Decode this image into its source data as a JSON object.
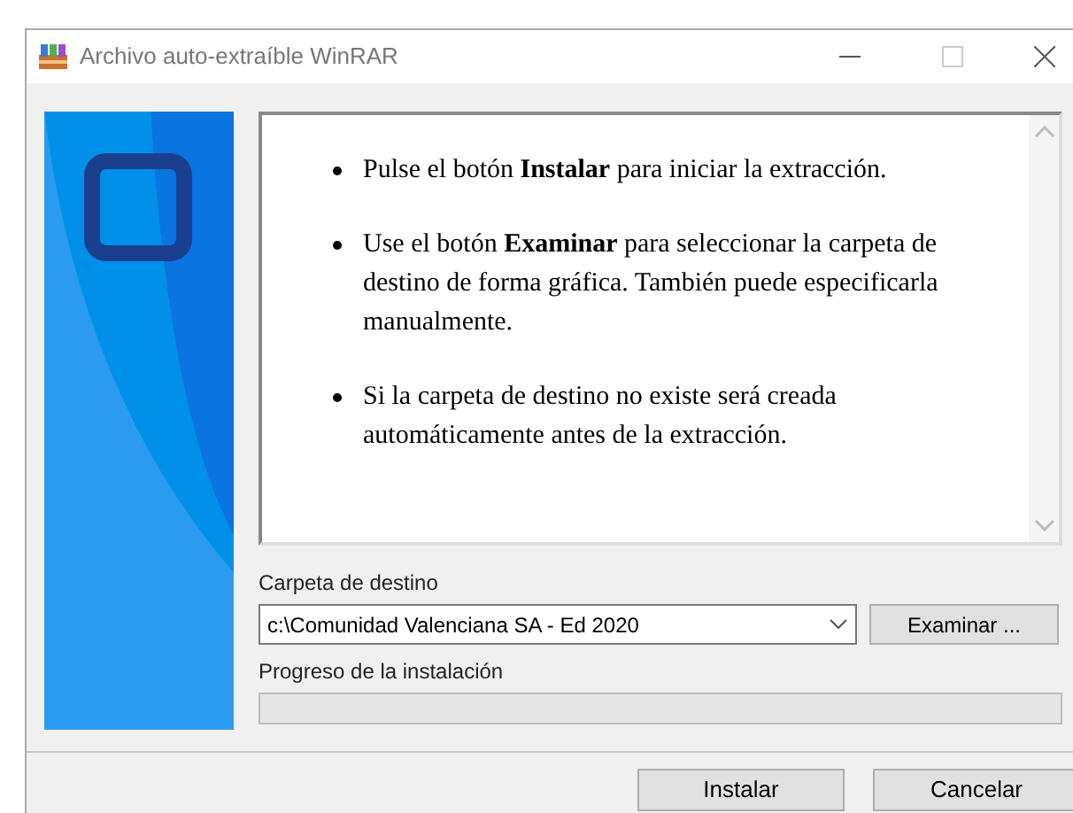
{
  "window": {
    "title": "Archivo auto-extraíble WinRAR"
  },
  "info": {
    "items": [
      "Pulse el botón **Instalar** para iniciar la extracción.",
      "Use el botón **Examinar** para seleccionar la carpeta de destino de forma gráfica. También puede especificarla manualmente.",
      "Si la carpeta de destino no existe será creada automáticamente antes de la extracción."
    ]
  },
  "destination": {
    "label": "Carpeta de destino",
    "value": "c:\\Comunidad Valenciana SA - Ed 2020",
    "browse_button": "Examinar ..."
  },
  "progress": {
    "label": "Progreso de la instalación",
    "level": 0
  },
  "buttons": [
    "Instalar",
    "Cancelar"
  ]
}
